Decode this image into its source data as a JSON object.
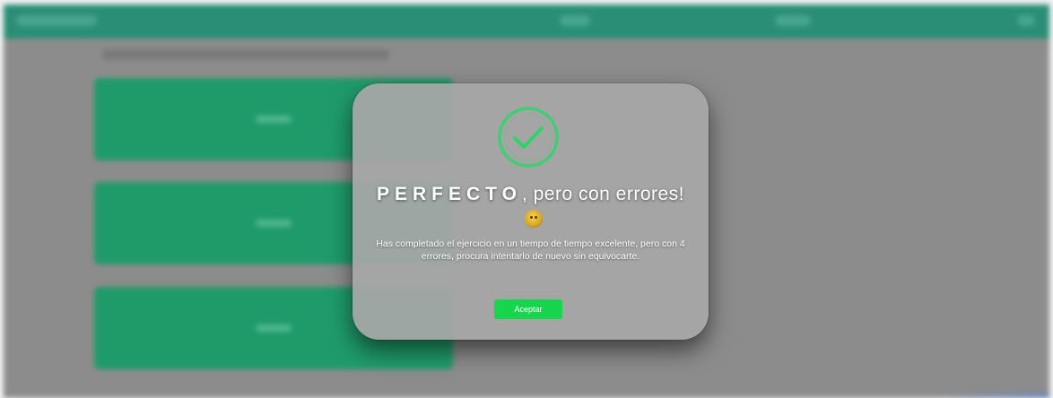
{
  "modal": {
    "title_spaced": "PERFECTO",
    "title_rest": ", pero con errores!",
    "message": "Has completado el ejercicio en un tiempo de tiempo excelente, pero con 4 errores, procura intentarlo de nuevo sin equivocarte.",
    "accept_label": "Aceptar",
    "icon": "check-circle-icon",
    "emoji_icon": "grimacing-emoji-icon"
  },
  "colors": {
    "header": "#2a8e76",
    "card": "#1f9b6a",
    "check": "#2fd36a",
    "accept_button": "#17d64e",
    "overlay": "#8c8c8c"
  }
}
